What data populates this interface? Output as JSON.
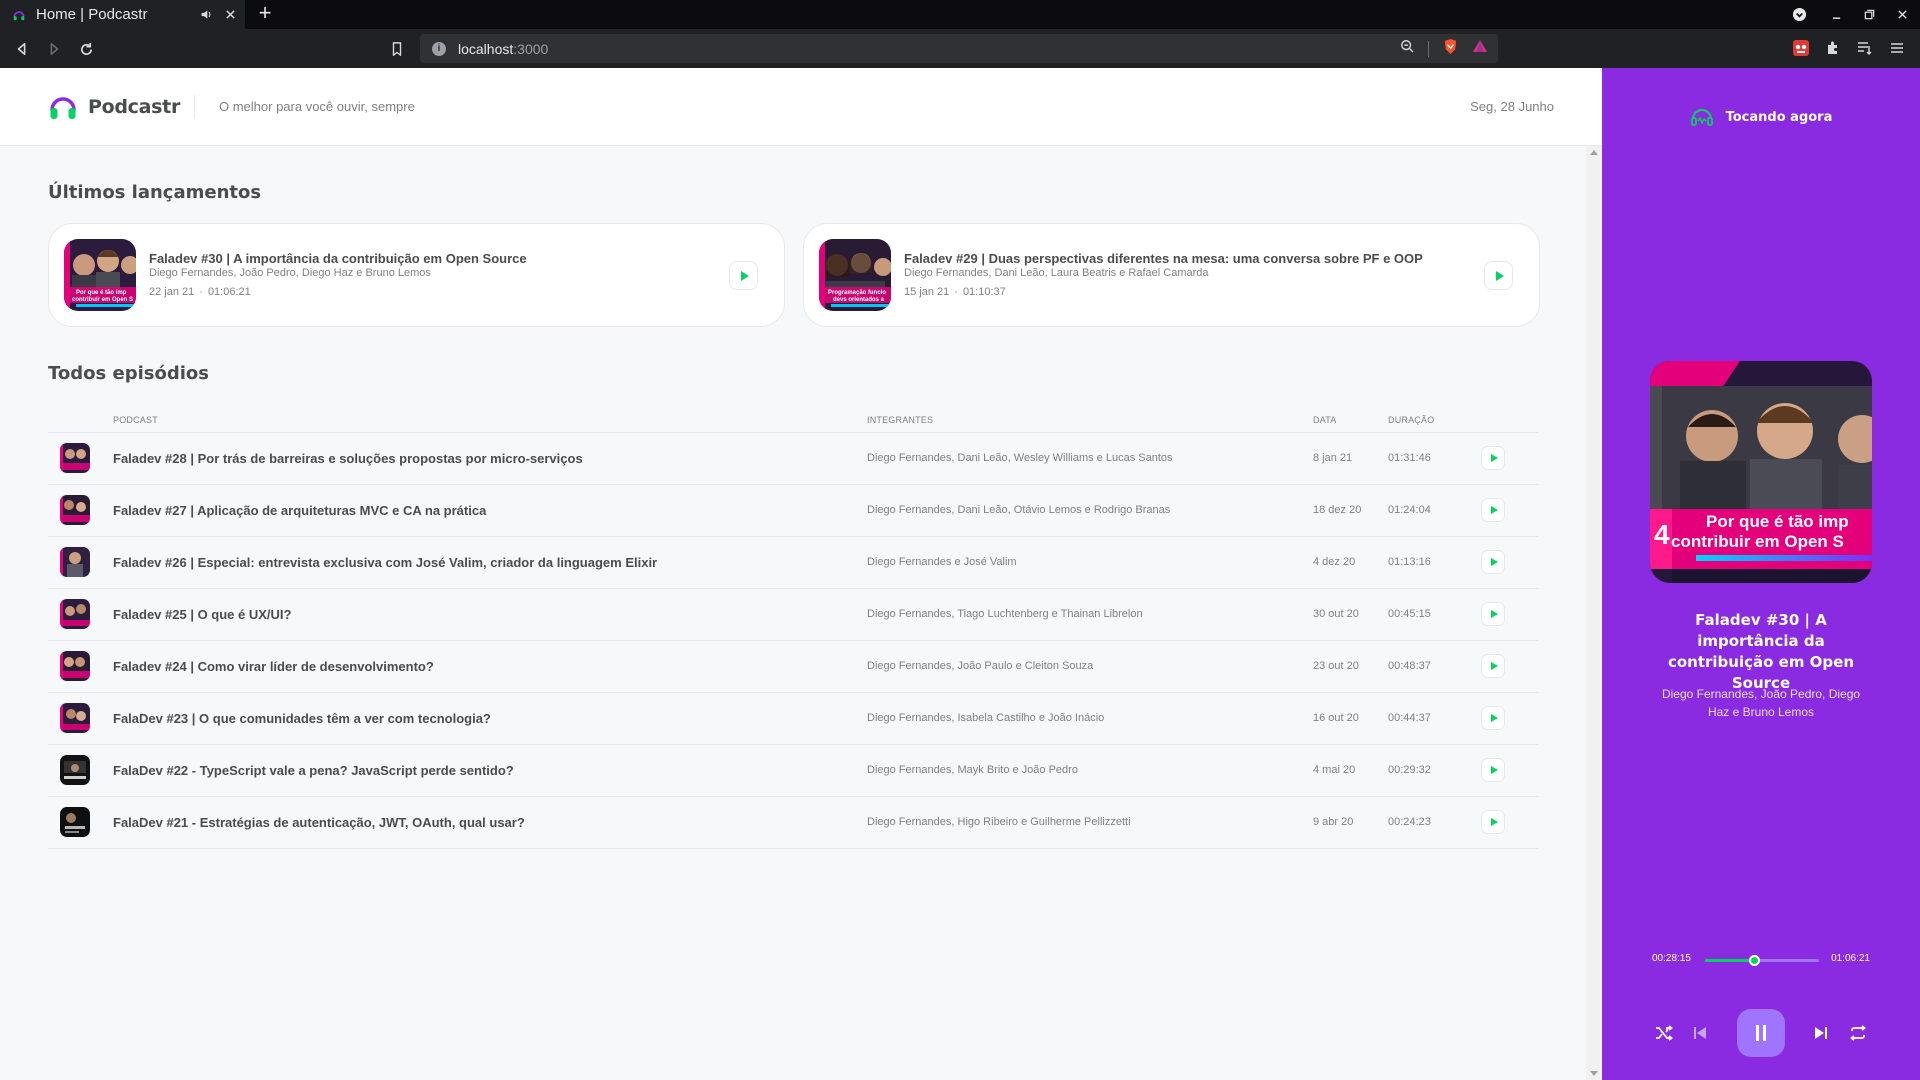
{
  "browser": {
    "tab_title": "Home | Podcastr",
    "url_host": "localhost",
    "url_port": ":3000"
  },
  "header": {
    "logo_text": "Podcastr",
    "tagline": "O melhor para você ouvir, sempre",
    "date": "Seg, 28 Junho"
  },
  "latest": {
    "title": "Últimos lançamentos",
    "episodes": [
      {
        "title": "Faladev #30 | A importância da contribuição em Open Source",
        "members": "Diego Fernandes, João Pedro, Diego Haz e Bruno Lemos",
        "date": "22 jan 21",
        "duration": "01:06:21"
      },
      {
        "title": "Faladev #29 | Duas perspectivas diferentes na mesa: uma conversa sobre PF e OOP",
        "members": "Diego Fernandes, Dani Leão, Laura Beatris e Rafael Camarda",
        "date": "15 jan 21",
        "duration": "01:10:37"
      }
    ],
    "dot": "·"
  },
  "all": {
    "title": "Todos episódios",
    "columns": {
      "podcast": "Podcast",
      "members": "Integrantes",
      "date": "Data",
      "duration": "Duração"
    },
    "rows": [
      {
        "title": "Faladev #28 | Por trás de barreiras e soluções propostas por micro-serviços",
        "members": "Diego Fernandes, Dani Leão, Wesley Williams e Lucas Santos",
        "date": "8 jan 21",
        "duration": "01:31:46"
      },
      {
        "title": "Faladev #27 | Aplicação de arquiteturas MVC e CA na prática",
        "members": "Diego Fernandes, Dani Leão, Otávio Lemos e Rodrigo Branas",
        "date": "18 dez 20",
        "duration": "01:24:04"
      },
      {
        "title": "Faladev #26 | Especial: entrevista exclusiva com José Valim, criador da linguagem Elixir",
        "members": "Diego Fernandes e José Valim",
        "date": "4 dez 20",
        "duration": "01:13:16"
      },
      {
        "title": "Faladev #25 | O que é UX/UI?",
        "members": "Diego Fernandes, Tiago Luchtenberg e Thainan Librelon",
        "date": "30 out 20",
        "duration": "00:45:15"
      },
      {
        "title": "Faladev #24 | Como virar líder de desenvolvimento?",
        "members": "Diego Fernandes, João Paulo e Cleiton Souza",
        "date": "23 out 20",
        "duration": "00:48:37"
      },
      {
        "title": "FalaDev #23 | O que comunidades têm a ver com tecnologia?",
        "members": "Diego Fernandes, Isabela Castilho e João Inácio",
        "date": "16 out 20",
        "duration": "00:44:37"
      },
      {
        "title": "FalaDev #22 - TypeScript vale a pena? JavaScript perde sentido?",
        "members": "Diego Fernandes, Mayk Brito e João Pedro",
        "date": "4 mai 20",
        "duration": "00:29:32"
      },
      {
        "title": "FalaDev #21 - Estratégias de autenticação, JWT, OAuth, qual usar?",
        "members": "Diego Fernandes, Higo Ribeiro e Guilherme Pellizzetti",
        "date": "9 abr 20",
        "duration": "00:24:23"
      }
    ]
  },
  "player": {
    "header": "Tocando agora",
    "cover_text_line1": "Por que é tão imp",
    "cover_text_line2": "contribuir em Open S",
    "title": "Faladev #30 | A importância da contribuição em Open Source",
    "members": "Diego Fernandes, João Pedro, Diego Haz e Bruno Lemos",
    "current_time": "00:28:15",
    "total_time": "01:06:21",
    "progress": 0.426
  },
  "colors": {
    "brand_purple": "#8a2be2",
    "accent_green": "#04d361",
    "card_border": "#e6e8eb",
    "text_dark": "#494d4b",
    "text_muted": "#808080"
  }
}
